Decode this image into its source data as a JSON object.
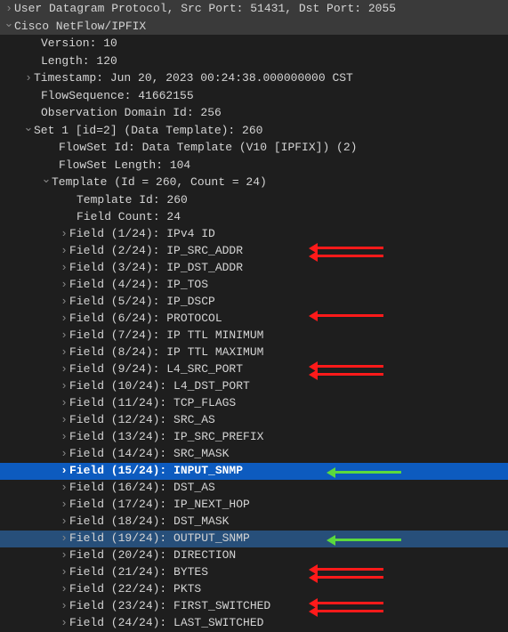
{
  "top": {
    "udp": "User Datagram Protocol, Src Port: 51431, Dst Port: 2055",
    "cisco": "Cisco NetFlow/IPFIX"
  },
  "info": {
    "version": "Version: 10",
    "length": "Length: 120",
    "timestamp": "Timestamp: Jun 20, 2023 00:24:38.000000000 CST",
    "flowsequence": "FlowSequence: 41662155",
    "obs": "Observation Domain Id: 256"
  },
  "set1": {
    "label": "Set 1 [id=2] (Data Template): 260",
    "flowset_id": "FlowSet Id: Data Template (V10 [IPFIX]) (2)",
    "flowset_len": "FlowSet Length: 104"
  },
  "template": {
    "label": "Template (Id = 260, Count = 24)",
    "id": "Template Id: 260",
    "count": "Field Count: 24"
  },
  "fields": [
    {
      "label": "Field (1/24): IPv4 ID",
      "arrow": null,
      "selected": false
    },
    {
      "label": "Field (2/24): IP_SRC_ADDR",
      "arrow": "red-double",
      "selected": false
    },
    {
      "label": "Field (3/24): IP_DST_ADDR",
      "arrow": null,
      "selected": false
    },
    {
      "label": "Field (4/24): IP_TOS",
      "arrow": null,
      "selected": false
    },
    {
      "label": "Field (5/24): IP_DSCP",
      "arrow": null,
      "selected": false
    },
    {
      "label": "Field (6/24): PROTOCOL",
      "arrow": "red",
      "selected": false
    },
    {
      "label": "Field (7/24): IP TTL MINIMUM",
      "arrow": null,
      "selected": false
    },
    {
      "label": "Field (8/24): IP TTL MAXIMUM",
      "arrow": null,
      "selected": false
    },
    {
      "label": "Field (9/24): L4_SRC_PORT",
      "arrow": "red-double",
      "selected": false
    },
    {
      "label": "Field (10/24): L4_DST_PORT",
      "arrow": null,
      "selected": false
    },
    {
      "label": "Field (11/24): TCP_FLAGS",
      "arrow": null,
      "selected": false
    },
    {
      "label": "Field (12/24): SRC_AS",
      "arrow": null,
      "selected": false
    },
    {
      "label": "Field (13/24): IP_SRC_PREFIX",
      "arrow": null,
      "selected": false
    },
    {
      "label": "Field (14/24): SRC_MASK",
      "arrow": null,
      "selected": false
    },
    {
      "label": "Field (15/24): INPUT_SNMP",
      "arrow": "green",
      "selected": "primary"
    },
    {
      "label": "Field (16/24): DST_AS",
      "arrow": null,
      "selected": false
    },
    {
      "label": "Field (17/24): IP_NEXT_HOP",
      "arrow": null,
      "selected": false
    },
    {
      "label": "Field (18/24): DST_MASK",
      "arrow": null,
      "selected": false
    },
    {
      "label": "Field (19/24): OUTPUT_SNMP",
      "arrow": "green",
      "selected": "secondary"
    },
    {
      "label": "Field (20/24): DIRECTION",
      "arrow": null,
      "selected": false
    },
    {
      "label": "Field (21/24): BYTES",
      "arrow": "red-double",
      "selected": false
    },
    {
      "label": "Field (22/24): PKTS",
      "arrow": null,
      "selected": false
    },
    {
      "label": "Field (23/24): FIRST_SWITCHED",
      "arrow": "red-double",
      "selected": false
    },
    {
      "label": "Field (24/24): LAST_SWITCHED",
      "arrow": null,
      "selected": false
    }
  ]
}
